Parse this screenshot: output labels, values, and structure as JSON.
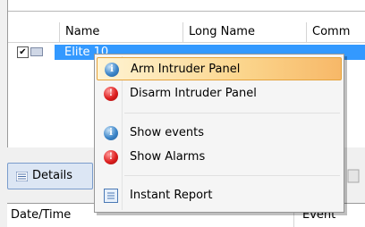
{
  "grid": {
    "columns": [
      {
        "label": ""
      },
      {
        "label": "Name"
      },
      {
        "label": "Long Name"
      },
      {
        "label": "Comm"
      }
    ],
    "rows": [
      {
        "checked": true,
        "name": "Elite 10"
      }
    ]
  },
  "context_menu": {
    "items": [
      {
        "label": "Arm Intruder Panel",
        "icon": "info-icon",
        "highlighted": true
      },
      {
        "label": "Disarm Intruder Panel",
        "icon": "alert-icon"
      },
      {
        "label": "Show events",
        "icon": "info-icon"
      },
      {
        "label": "Show Alarms",
        "icon": "alert-icon"
      },
      {
        "label": "Instant Report",
        "icon": "report-icon"
      }
    ]
  },
  "lower_panel": {
    "tab_label": "Details",
    "list_columns": [
      "Date/Time",
      "Event"
    ]
  },
  "colors": {
    "selection": "#3399ff",
    "menu_highlight": "#fbd58c"
  }
}
